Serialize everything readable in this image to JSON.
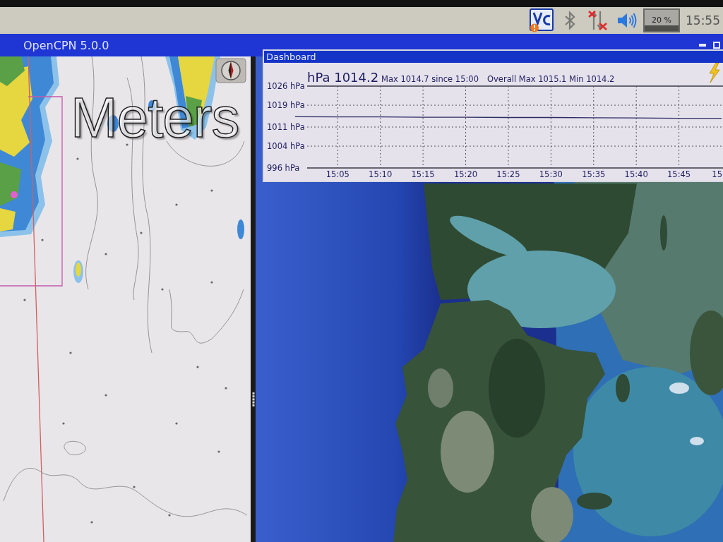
{
  "panel": {
    "network": {
      "connected": false
    },
    "cpu": "20 %",
    "clock": "15:55"
  },
  "window": {
    "title": "OpenCPN 5.0.0"
  },
  "chart_pane": {
    "overlay_label": "Meters"
  },
  "dashboard": {
    "title": "Dashboard",
    "reading": "hPa 1014.2",
    "stats": [
      "Max 1014.7 since 15:00",
      "Overall Max 1015.1 Min 1014.2"
    ],
    "chart_data": {
      "type": "line",
      "categories": [
        null,
        "15:05",
        "15:10",
        "15:15",
        "15:20",
        "15:25",
        "15:30",
        "15:35",
        "15:40",
        "15:45",
        "15"
      ],
      "values": [
        1014.8,
        1014.7,
        1014.7,
        1014.6,
        1014.6,
        1014.5,
        1014.5,
        1014.4,
        1014.3,
        1014.2,
        1014.2
      ],
      "ylim": [
        996,
        1026
      ],
      "yticks": [
        {
          "value": 1026,
          "label": "1026 hPa"
        },
        {
          "value": 1019,
          "label": "1019 hPa"
        },
        {
          "value": 1011,
          "label": "1011 hPa"
        },
        {
          "value": 1004,
          "label": "1004 hPa"
        },
        {
          "value": 996,
          "label": "996 hPa"
        }
      ],
      "grid": true
    }
  }
}
